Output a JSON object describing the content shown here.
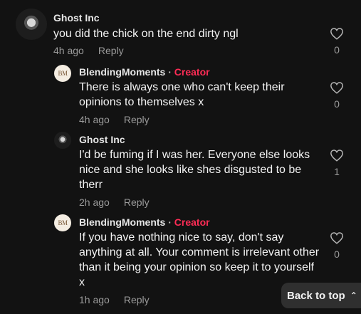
{
  "comments": [
    {
      "username": "Ghost Inc",
      "creator_tag": "",
      "text": "you did the chick on the end dirty ngl",
      "time": "4h ago",
      "reply_label": "Reply",
      "likes": "0",
      "avatar_icon": "ghost-avatar"
    },
    {
      "username": "BlendingMoments",
      "creator_tag": "Creator",
      "text": "There is always one who can't keep their opinions to themselves x",
      "time": "4h ago",
      "reply_label": "Reply",
      "likes": "0",
      "avatar_icon": "bm-avatar",
      "avatar_text": "BM"
    },
    {
      "username": "Ghost Inc",
      "creator_tag": "",
      "text": "I'd be fuming if I was her. Everyone else looks nice and she looks like shes disgusted to be therr",
      "time": "2h ago",
      "reply_label": "Reply",
      "likes": "1",
      "avatar_icon": "ghost-avatar"
    },
    {
      "username": "BlendingMoments",
      "creator_tag": "Creator",
      "text": "If you have nothing nice to say, don't say anything at all. Your comment is irrelevant other than it being your opinion so keep it to yourself x",
      "time": "1h ago",
      "reply_label": "Reply",
      "likes": "0",
      "avatar_icon": "bm-avatar",
      "avatar_text": "BM"
    }
  ],
  "separator": "·",
  "back_to_top": {
    "label": "Back to top",
    "icon": "chevron-up-icon"
  },
  "colors": {
    "background": "#121212",
    "creator_accent": "#fe2c55",
    "muted_text": "#9b9b9b"
  }
}
